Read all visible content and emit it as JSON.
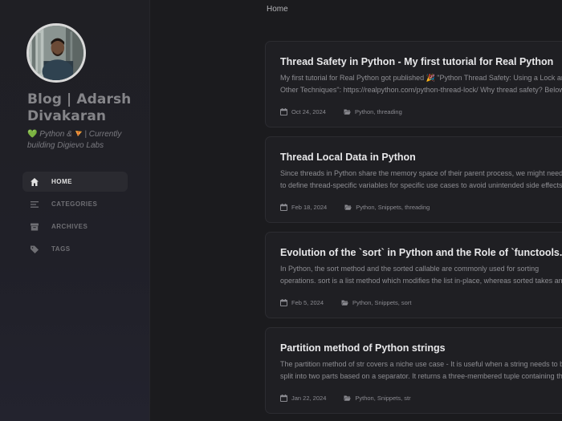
{
  "sidebar": {
    "title": "Blog | Adarsh Divakaran",
    "subtitle_heart": "💚",
    "subtitle_part1": " Python & ",
    "subtitle_part2": " | Currently building Digievo Labs",
    "nav": [
      {
        "label": "HOME",
        "icon": "home-icon",
        "active": true
      },
      {
        "label": "CATEGORIES",
        "icon": "categories-icon",
        "active": false
      },
      {
        "label": "ARCHIVES",
        "icon": "archive-icon",
        "active": false
      },
      {
        "label": "TAGS",
        "icon": "tags-icon",
        "active": false
      }
    ]
  },
  "breadcrumb": "Home",
  "posts": [
    {
      "title": "Thread Safety in Python - My first tutorial for Real Python",
      "excerpt": "My first tutorial for Real Python got published 🎉 \"Python Thread Safety: Using a Lock and Other Techniques\": https://realpython.com/python-thread-lock/ Why thread safety? Below",
      "date": "Oct 24, 2024",
      "categories": "Python, threading"
    },
    {
      "title": "Thread Local Data in Python",
      "excerpt": "Since threads in Python share the memory space of their parent process, we might need to define thread-specific variables for specific use cases to avoid unintended side effects. In this article",
      "date": "Feb 18, 2024",
      "categories": "Python, Snippets, threading"
    },
    {
      "title": "Evolution of the `sort` in Python and the Role of `functools.cmp_to_key`",
      "excerpt": "In Python, the sort method and the sorted callable are commonly used for sorting operations. sort is a list method which modifies the list in-place, whereas sorted takes an iterable as its first",
      "date": "Feb 5, 2024",
      "categories": "Python, Snippets, sort"
    },
    {
      "title": "Partition method of Python strings",
      "excerpt": "The partition method of str covers a niche use case - It is useful when a string needs to be split into two parts based on a separator. It returns a three-membered tuple containing the part",
      "date": "Jan 22, 2024",
      "categories": "Python, Snippets, str"
    }
  ]
}
